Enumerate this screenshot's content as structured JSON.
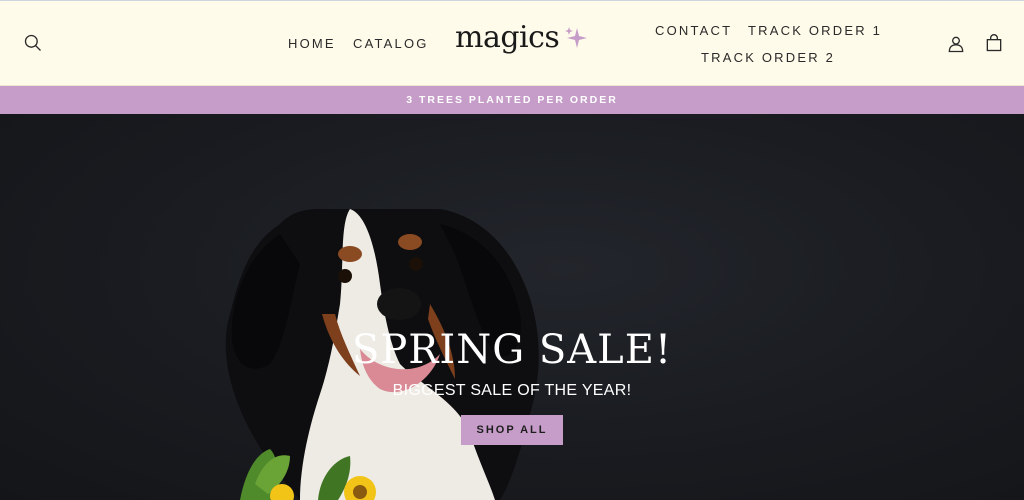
{
  "header": {
    "nav_left": [
      "HOME",
      "CATALOG"
    ],
    "nav_right": [
      "CONTACT",
      "TRACK ORDER 1",
      "TRACK ORDER 2"
    ],
    "logo_text": "magics",
    "icons": {
      "search": "search-icon",
      "account": "user-icon",
      "cart": "shopping-bag-icon",
      "logo_mark": "sparkle-icon"
    }
  },
  "announcement": {
    "text": "3 TREES PLANTED PER ORDER",
    "background": "#c69dc9"
  },
  "hero": {
    "title": "SPRING SALE!",
    "subtitle": "BIGGEST SALE OF THE YEAR!",
    "cta_label": "SHOP ALL",
    "cta_color": "#c69dc9"
  },
  "colors": {
    "header_bg": "#fffbea",
    "accent": "#c69dc9",
    "hero_bg": "#191b20",
    "text_dark": "#2a2a2a"
  }
}
